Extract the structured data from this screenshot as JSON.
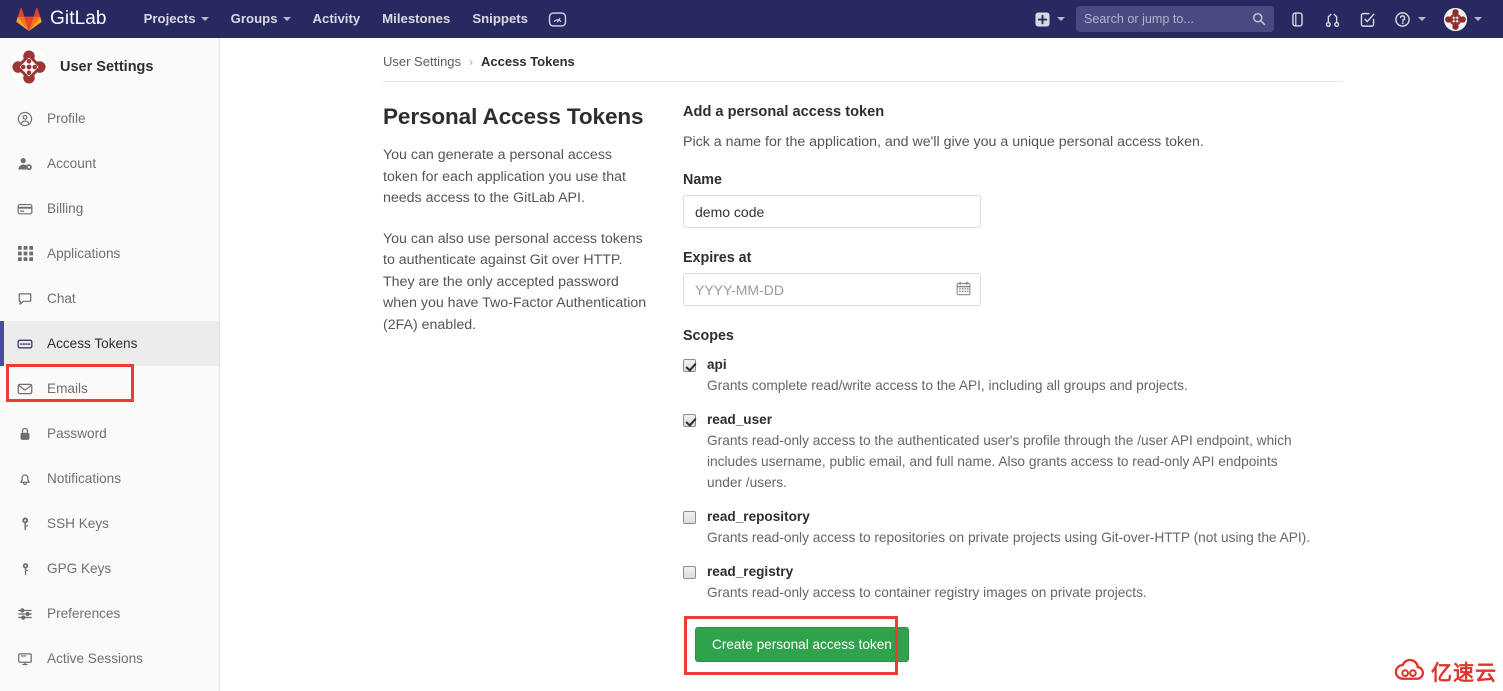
{
  "navbar": {
    "brand": "GitLab",
    "logo_icon": "gitlab-tanuki-icon",
    "links": [
      {
        "label": "Projects",
        "has_caret": true
      },
      {
        "label": "Groups",
        "has_caret": true
      },
      {
        "label": "Activity",
        "has_caret": false
      },
      {
        "label": "Milestones",
        "has_caret": false
      },
      {
        "label": "Snippets",
        "has_caret": false
      }
    ],
    "dashboard_icon": "speedometer-icon",
    "create_new_icon": "plus-square-icon",
    "create_new_caret": true,
    "search": {
      "placeholder": "Search or jump to...",
      "value": "",
      "icon": "search-icon"
    },
    "right_icons": [
      {
        "name": "issues-icon"
      },
      {
        "name": "merge-requests-icon"
      },
      {
        "name": "todos-icon"
      },
      {
        "name": "help-question-icon",
        "has_caret": true
      }
    ],
    "avatar_icon": "user-avatar-identicon",
    "avatar_caret": true,
    "bg_color": "#292961"
  },
  "sidebar": {
    "title": "User Settings",
    "avatar_icon": "user-avatar-identicon",
    "active_item": "Access Tokens",
    "active_indicator_color": "#4b4ba3",
    "highlight_color": "#ef3b36",
    "items": [
      {
        "label": "Profile",
        "icon": "user-circle-icon",
        "active": false
      },
      {
        "label": "Account",
        "icon": "account-gear-icon",
        "active": false
      },
      {
        "label": "Billing",
        "icon": "credit-card-icon",
        "active": false
      },
      {
        "label": "Applications",
        "icon": "grid-apps-icon",
        "active": false
      },
      {
        "label": "Chat",
        "icon": "speech-bubble-icon",
        "active": false
      },
      {
        "label": "Access Tokens",
        "icon": "token-card-icon",
        "active": true
      },
      {
        "label": "Emails",
        "icon": "envelope-icon",
        "active": false
      },
      {
        "label": "Password",
        "icon": "lock-icon",
        "active": false
      },
      {
        "label": "Notifications",
        "icon": "bell-icon",
        "active": false
      },
      {
        "label": "SSH Keys",
        "icon": "key-icon",
        "active": false
      },
      {
        "label": "GPG Keys",
        "icon": "key-icon",
        "active": false
      },
      {
        "label": "Preferences",
        "icon": "sliders-icon",
        "active": false
      },
      {
        "label": "Active Sessions",
        "icon": "monitor-icon",
        "active": false
      }
    ]
  },
  "breadcrumb": {
    "root": "User Settings",
    "separator": "›",
    "current": "Access Tokens"
  },
  "left_panel": {
    "title": "Personal Access Tokens",
    "paragraph_1": "You can generate a personal access token for each application you use that needs access to the GitLab API.",
    "paragraph_2": "You can also use personal access tokens to authenticate against Git over HTTP. They are the only accepted password when you have Two-Factor Authentication (2FA) enabled."
  },
  "form": {
    "title": "Add a personal access token",
    "subtitle": "Pick a name for the application, and we'll give you a unique personal access token.",
    "name_label": "Name",
    "name_value": "demo code",
    "name_placeholder": "",
    "expires_label": "Expires at",
    "expires_value": "",
    "expires_placeholder": "YYYY-MM-DD",
    "calendar_icon": "calendar-icon",
    "scopes_label": "Scopes",
    "scopes": [
      {
        "name": "api",
        "checked": true,
        "description": "Grants complete read/write access to the API, including all groups and projects."
      },
      {
        "name": "read_user",
        "checked": true,
        "description": "Grants read-only access to the authenticated user's profile through the /user API endpoint, which includes username, public email, and full name. Also grants access to read-only API endpoints under /users."
      },
      {
        "name": "read_repository",
        "checked": false,
        "description": "Grants read-only access to repositories on private projects using Git-over-HTTP (not using the API)."
      },
      {
        "name": "read_registry",
        "checked": false,
        "description": "Grants read-only access to container registry images on private projects."
      }
    ],
    "submit_label": "Create personal access token",
    "submit_color": "#31a24c",
    "submit_highlight_color": "#ef3b36"
  },
  "watermark": {
    "text": "亿速云",
    "icon": "cloud-logo-icon",
    "color": "#e2342a"
  }
}
